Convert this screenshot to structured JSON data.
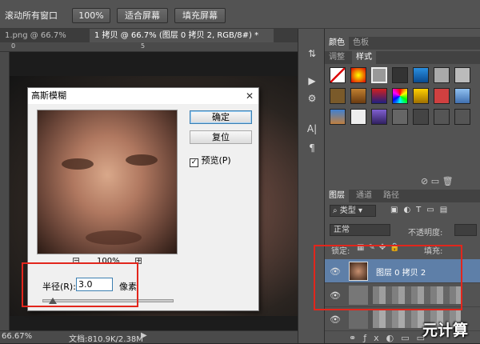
{
  "options_bar": {
    "scroll_all_windows": "滚动所有窗口",
    "zoom_100": "100%",
    "fit_screen": "适合屏幕",
    "fill_screen": "填充屏幕"
  },
  "doc_tabs": [
    {
      "label": "1.png @ 66.7% (图...",
      "close": "×"
    },
    {
      "label": "1 拷贝 @ 66.7% (图层 0 拷贝 2, RGB/8#) *",
      "close": "×"
    }
  ],
  "ruler_ticks": [
    "0",
    "5"
  ],
  "status": {
    "zoom": "66.67%",
    "doc_info": "文档:810.9K/2.38M"
  },
  "panels": {
    "color_tabs": [
      "颜色",
      "色板"
    ],
    "adjust_tabs": [
      "调整",
      "样式"
    ],
    "layer_tabs": [
      "图层",
      "通道",
      "路径"
    ],
    "kind_filter": "类型",
    "blend_mode": "正常",
    "opacity_label": "不透明度:",
    "lock_label": "锁定:",
    "fill_label": "填充:",
    "layer_name": "图层 0 拷贝 2"
  },
  "dialog": {
    "title": "高斯模糊",
    "close": "✕",
    "ok": "确定",
    "reset": "复位",
    "preview_label": "预览(P)",
    "preview_checked": true,
    "zoom_level": "100%",
    "radius_label": "半径(R):",
    "radius_value": "3.0",
    "radius_unit": "像素",
    "slider_position": 0.08
  },
  "watermark": "元计算",
  "colors": {
    "highlight": "#e2261c",
    "panel_bg": "#535353",
    "dialog_bg": "#f0f0f0"
  }
}
